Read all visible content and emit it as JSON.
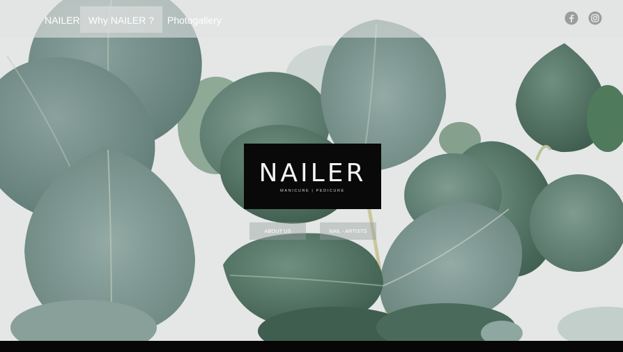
{
  "nav": {
    "items": [
      {
        "label": "NAILER"
      },
      {
        "label": "Why  NAILER ?"
      },
      {
        "label": "Photogallery"
      }
    ]
  },
  "social": {
    "icons": [
      "facebook-icon",
      "instagram-icon"
    ]
  },
  "logo": {
    "word": "NAILER",
    "subtitle": "MANICURE | PEDICURE"
  },
  "buttons": {
    "about": "ABOUT US",
    "artists": "NAIL - ARTISTS"
  },
  "colors": {
    "leaf_dark": "#4d6b5e",
    "leaf_light": "#8faaa4",
    "background": "#e9ebea",
    "logo_bg": "#090909",
    "bottom_bar": "#070707"
  }
}
